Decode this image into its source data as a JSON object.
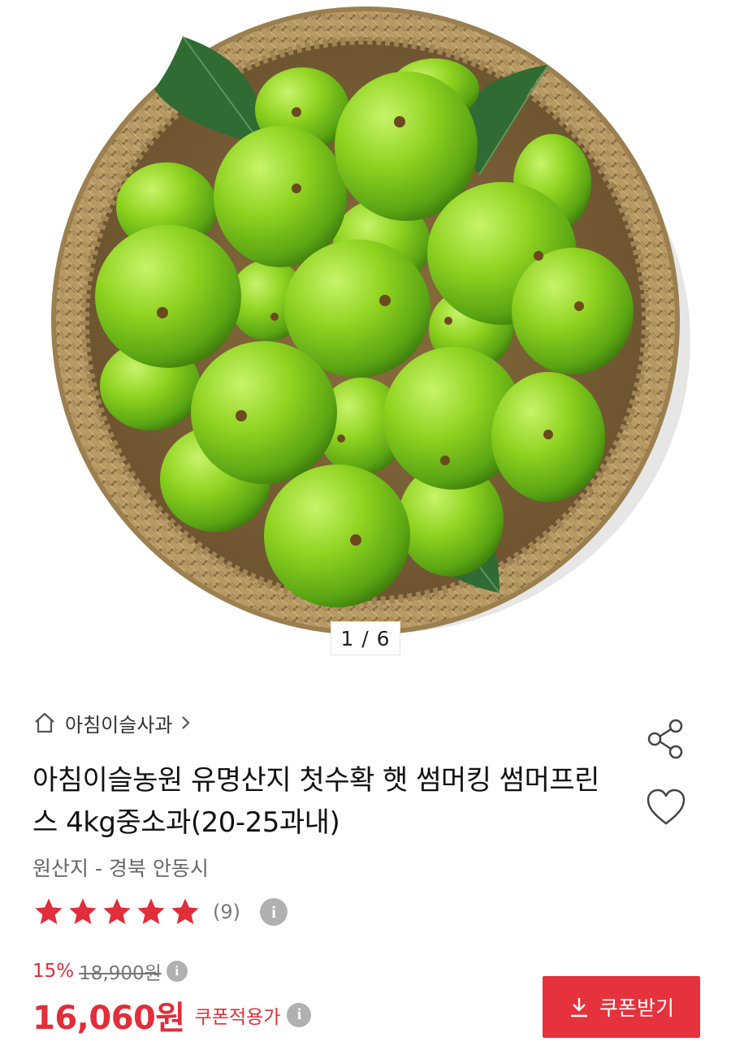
{
  "gallery": {
    "current_page": "1 / 6"
  },
  "product": {
    "brand_link": "아침이슬사과",
    "title": "아침이슬농원 유명산지 첫수확 햇 썸머킹 썸머프린스 4kg중소과(20-25과내)",
    "origin": "원산지 - 경북 안동시",
    "rating": {
      "stars": 5,
      "count_text": "(9)"
    }
  },
  "pricing": {
    "discount_rate": "15%",
    "original_price": "18,900원",
    "sale_price": "16,060원",
    "coupon_label": "쿠폰적용가",
    "info_glyph": "i"
  },
  "actions": {
    "coupon_button_label": "쿠폰받기",
    "share_icon": "share-icon",
    "wishlist_icon": "heart-icon"
  },
  "colors": {
    "accent_red": "#e22d3a",
    "apple_green": "#8fd31f",
    "basket": "#b89a65"
  }
}
